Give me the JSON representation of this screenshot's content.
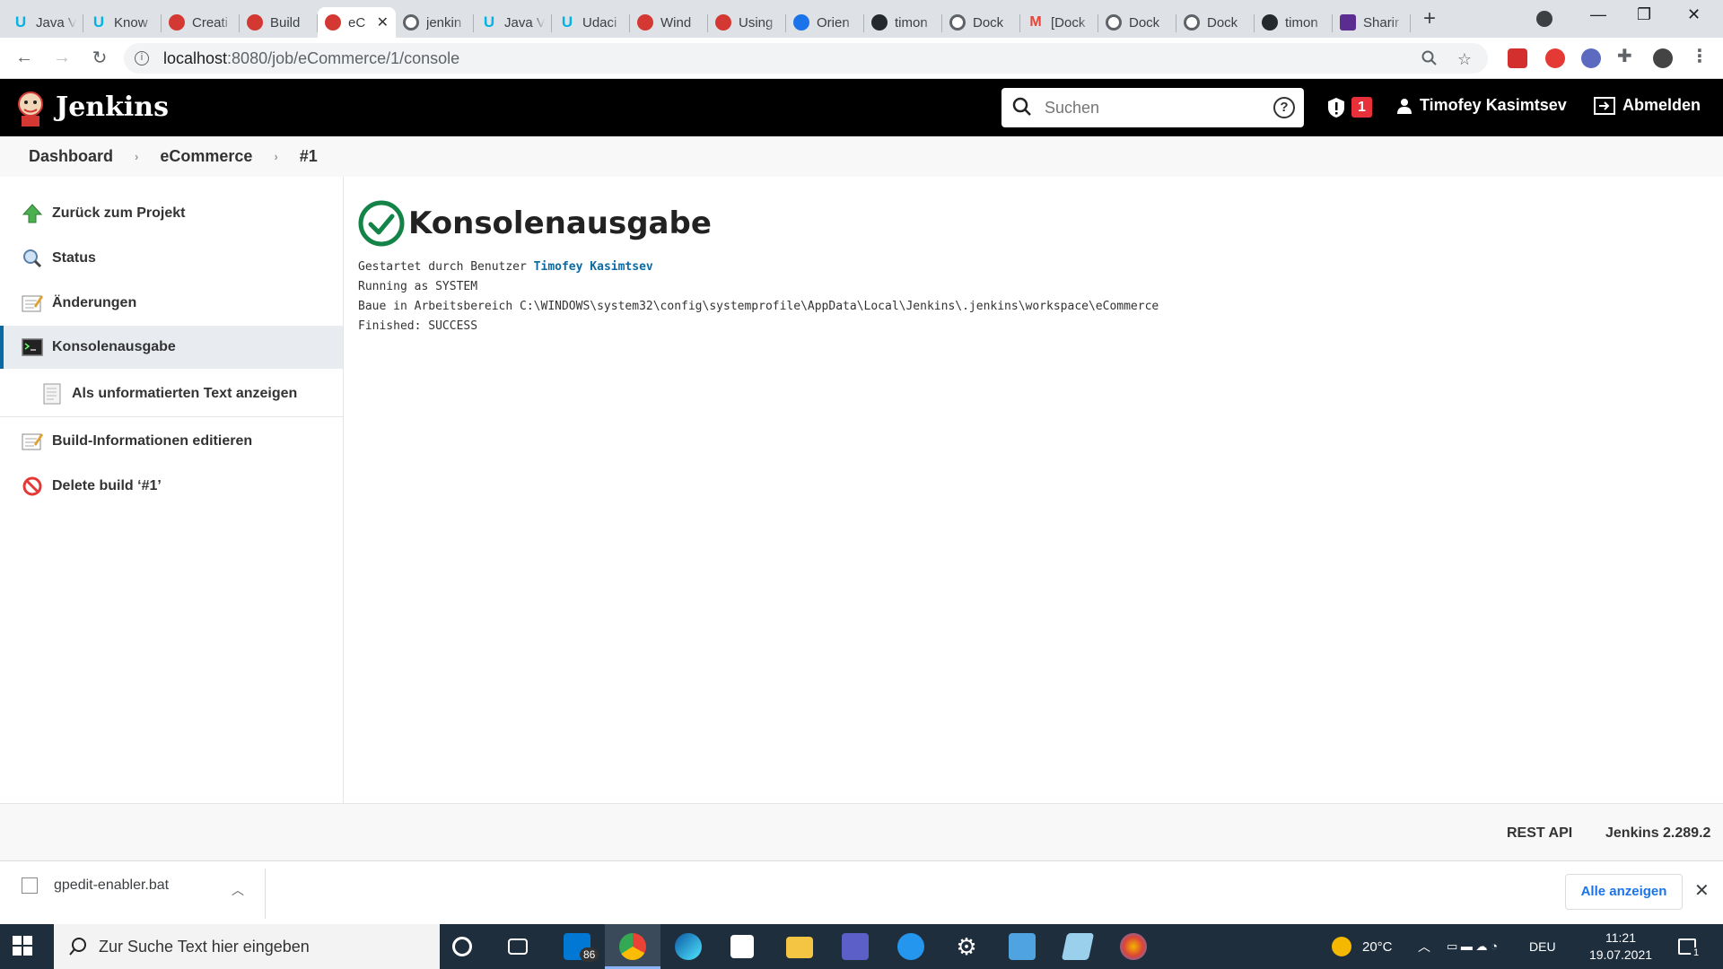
{
  "browser": {
    "tabs": [
      {
        "title": "Java V",
        "icon": "udacity"
      },
      {
        "title": "Know",
        "icon": "udacity"
      },
      {
        "title": "Creati",
        "icon": "jenkins"
      },
      {
        "title": "Build",
        "icon": "jenkins"
      },
      {
        "title": "eC",
        "icon": "jenkins",
        "active": true
      },
      {
        "title": "jenkin",
        "icon": "docker"
      },
      {
        "title": "Java V",
        "icon": "udacity"
      },
      {
        "title": "Udaci",
        "icon": "udacity"
      },
      {
        "title": "Wind",
        "icon": "jenkins"
      },
      {
        "title": "Using",
        "icon": "jenkins"
      },
      {
        "title": "Orien",
        "icon": "orient"
      },
      {
        "title": "timon",
        "icon": "github"
      },
      {
        "title": "Dock",
        "icon": "docker"
      },
      {
        "title": "[Dock",
        "icon": "gmail"
      },
      {
        "title": "Dock",
        "icon": "docker"
      },
      {
        "title": "Dock",
        "icon": "docker"
      },
      {
        "title": "timon",
        "icon": "github"
      },
      {
        "title": "Sharir",
        "icon": "sharing"
      }
    ],
    "url_host": "localhost",
    "url_path": ":8080/job/eCommerce/1/console"
  },
  "header": {
    "brand": "Jenkins",
    "search_placeholder": "Suchen",
    "alert_count": "1",
    "user_name": "Timofey Kasimtsev",
    "logout_label": "Abmelden"
  },
  "breadcrumb": {
    "items": [
      "Dashboard",
      "eCommerce",
      "#1"
    ]
  },
  "sidebar": {
    "items": [
      {
        "label": "Zurück zum Projekt",
        "icon": "up-arrow-icon"
      },
      {
        "label": "Status",
        "icon": "magnifier-icon"
      },
      {
        "label": "Änderungen",
        "icon": "notepad-icon"
      },
      {
        "label": "Konsolenausgabe",
        "icon": "terminal-icon",
        "active": true
      },
      {
        "label": "Als unformatierten Text anzeigen",
        "icon": "document-icon",
        "sub": true
      },
      {
        "label": "Build-Informationen editieren",
        "icon": "notepad-icon"
      },
      {
        "label": "Delete build ‘#1’",
        "icon": "no-entry-icon"
      }
    ]
  },
  "main": {
    "title": "Konsolenausgabe",
    "console": {
      "line1_prefix": "Gestartet durch Benutzer ",
      "line1_user": "Timofey Kasimtsev",
      "line2": "Running as SYSTEM",
      "line3": "Baue in Arbeitsbereich C:\\WINDOWS\\system32\\config\\systemprofile\\AppData\\Local\\Jenkins\\.jenkins\\workspace\\eCommerce",
      "line4": "Finished: SUCCESS"
    }
  },
  "footer": {
    "rest_api": "REST API",
    "version": "Jenkins 2.289.2"
  },
  "download_bar": {
    "file_name": "gpedit-enabler.bat",
    "show_all_label": "Alle anzeigen"
  },
  "taskbar": {
    "search_placeholder": "Zur Suche Text hier eingeben",
    "mail_badge": "86",
    "temperature": "20°C",
    "language": "DEU",
    "time": "11:21",
    "date": "19.07.2021",
    "notifications": "1"
  },
  "colors": {
    "jenkins_header": "#000000",
    "link_blue": "#0b6aa2",
    "success_green": "#138347",
    "alert_red": "#e8303a"
  }
}
